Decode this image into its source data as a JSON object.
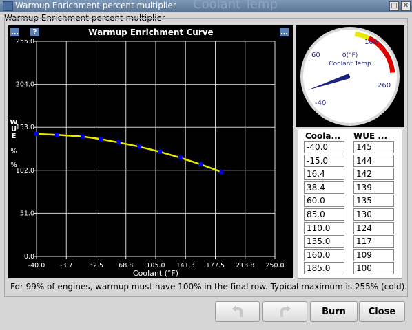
{
  "window": {
    "title": "Warmup Enrichment percent multiplier",
    "background_title": "Coolant Temp",
    "minimize_glyph": "□",
    "close_glyph": "✕"
  },
  "panel": {
    "title": "Warmup Enrichment percent multiplier"
  },
  "chart": {
    "more_glyph": "…",
    "help_glyph": "?"
  },
  "gauge": {
    "value_text": "0(°F)",
    "label": "Coolant Temp",
    "ticks": [
      "60",
      "160",
      "260",
      "-40"
    ],
    "accent": "#e8e800",
    "warn": "#e00000",
    "value": 0
  },
  "table": {
    "col1_header": "Coola...",
    "col2_header": "WUE ...",
    "coolant": [
      "-40.0",
      "-15.0",
      "16.4",
      "38.4",
      "60.0",
      "85.0",
      "110.0",
      "135.0",
      "160.0",
      "185.0"
    ],
    "wue": [
      "145",
      "144",
      "142",
      "139",
      "135",
      "130",
      "124",
      "117",
      "109",
      "100"
    ]
  },
  "footer": {
    "text": "For 99% of engines, warmup must have 100% in the final row. Typical maximum is 255% (cold)."
  },
  "buttons": {
    "undo_icon": "undo-icon",
    "redo_icon": "redo-icon",
    "burn": "Burn",
    "close": "Close"
  },
  "chart_data": {
    "type": "line",
    "title": "Warmup Enrichment Curve",
    "xlabel": "Coolant (°F)",
    "ylabel_lines": [
      "W",
      "U",
      "E",
      "%",
      "%"
    ],
    "x_ticks": [
      "-40.0",
      "-3.7",
      "32.5",
      "68.8",
      "105.0",
      "141.3",
      "177.5",
      "213.8",
      "250.0"
    ],
    "y_ticks": [
      "255.0",
      "204.0",
      "153.0",
      "102.0",
      "51.0",
      "0.0"
    ],
    "xlim": [
      -40,
      250
    ],
    "ylim": [
      0,
      255
    ],
    "grid": true,
    "series": [
      {
        "x": [
          -40,
          -15,
          16.4,
          38.4,
          60,
          85,
          110,
          135,
          160,
          185
        ],
        "y": [
          145,
          144,
          142,
          139,
          135,
          130,
          124,
          117,
          109,
          100
        ],
        "color": "#e8e800",
        "marker_color": "#0000e8"
      }
    ]
  }
}
